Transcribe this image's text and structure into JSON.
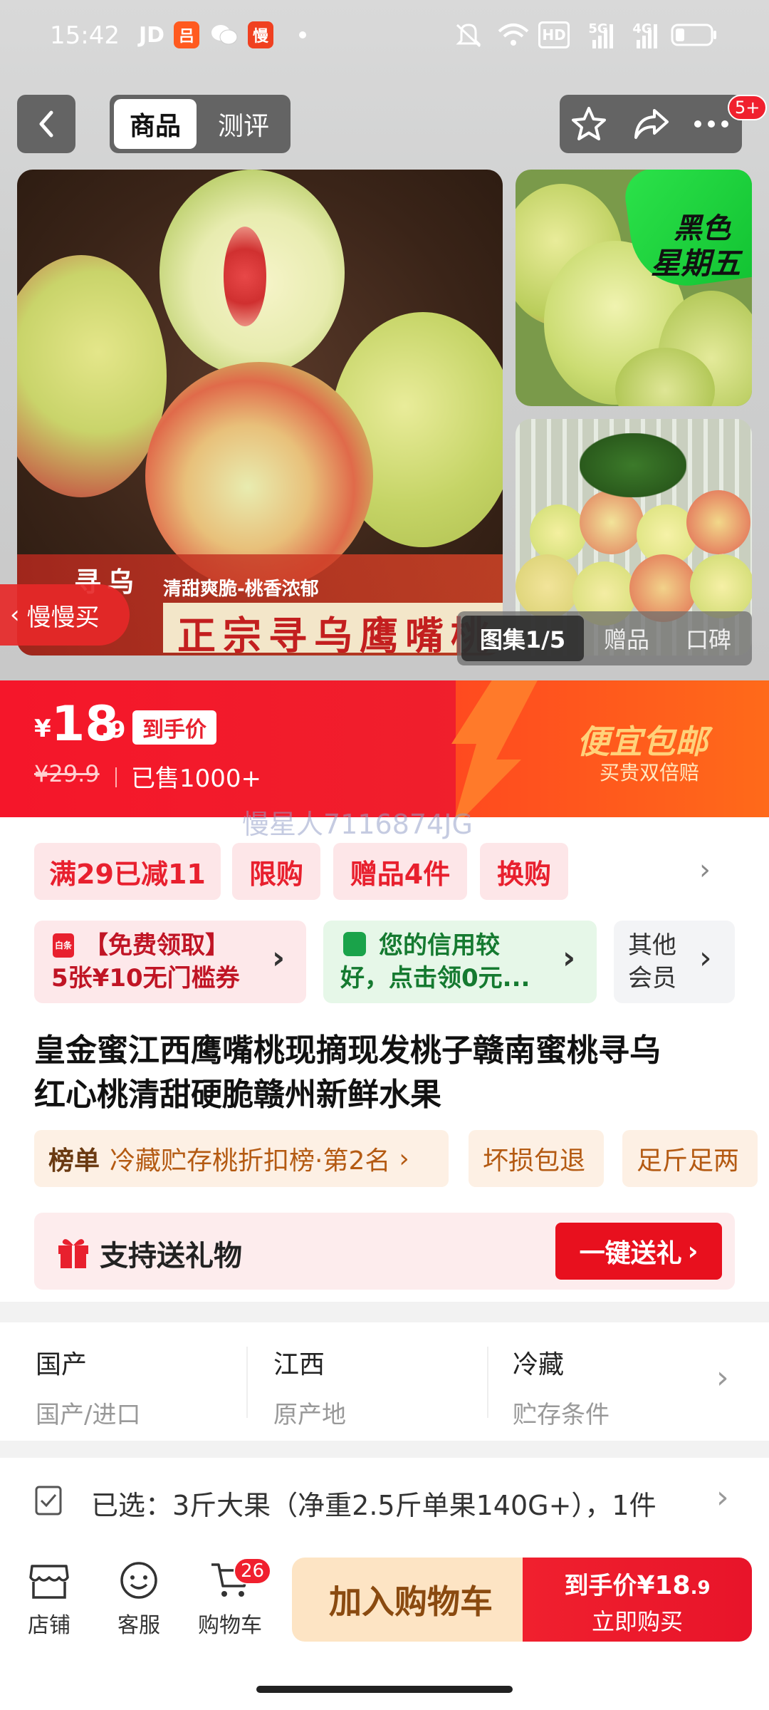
{
  "status_bar": {
    "time": "15:42",
    "icons": [
      "jd-app-icon",
      "meituan-app-icon",
      "wechat-icon",
      "slow-buy-app-icon",
      "dot-icon",
      "mute-icon",
      "wifi-icon",
      "hd-icon",
      "signal-5g-icon",
      "signal-4g-icon",
      "battery-icon"
    ],
    "hd_label": "HD",
    "net1": "5G",
    "net2": "4G"
  },
  "nav": {
    "tabs": [
      {
        "label": "商品",
        "active": true
      },
      {
        "label": "测评",
        "active": false
      }
    ],
    "badge": "5+"
  },
  "gallery": {
    "main_caption_top": "清甜爽脆-桃香浓郁",
    "main_caption_big": "正宗寻乌鹰嘴桃",
    "brand_mark": "寻乌",
    "promo_badge_line1": "黑色",
    "promo_badge_line2": "星期五",
    "slow_buy_label": "慢慢买",
    "tabs": [
      {
        "label": "图集1/5",
        "active": true
      },
      {
        "label": "赠品",
        "active": false
      },
      {
        "label": "口碑",
        "active": false
      }
    ]
  },
  "price": {
    "currency": "¥",
    "integer": "18",
    "decimal": ".9",
    "final_price_tag": "到手价",
    "original_price": "¥29.9",
    "sold": "已售1000+",
    "promo_title": "便宜包邮",
    "promo_sub": "买贵双倍赔",
    "watermark": "慢星人7116874JG"
  },
  "promo_tags": [
    "满29已减11",
    "限购",
    "赠品4件",
    "换购"
  ],
  "cards": {
    "coupon_icon_text": "白条",
    "coupon_line1": "【免费领取】",
    "coupon_line2": "5张¥10无门槛券",
    "credit_line1": "您的信用较",
    "credit_line2": "好，点击领0元...",
    "member_line1": "其他",
    "member_line2": "会员"
  },
  "product": {
    "title_line1": "皇金蜜江西鹰嘴桃现摘现发桃子赣南蜜桃寻乌",
    "title_line2": "红心桃清甜硬脆赣州新鲜水果"
  },
  "chips": {
    "rank_label": "榜单",
    "rank_text": "冷藏贮存桃折扣榜·第2名",
    "chip2": "坏损包退",
    "chip3": "足斤足两"
  },
  "gift": {
    "label": "支持送礼物",
    "button": "一键送礼"
  },
  "specs": [
    {
      "value": "国产",
      "label": "国产/进口"
    },
    {
      "value": "江西",
      "label": "原产地"
    },
    {
      "value": "冷藏",
      "label": "贮存条件"
    }
  ],
  "selected": {
    "text": "已选：3斤大果（净重2.5斤单果140G+），1件"
  },
  "bottom": {
    "store": "店铺",
    "service": "客服",
    "cart": "购物车",
    "cart_count": "26",
    "add_cart": "加入购物车",
    "buy_line1_prefix": "到手价",
    "buy_price": "¥18",
    "buy_price_dec": ".9",
    "buy_line2": "立即购买"
  },
  "colors": {
    "accent_red": "#f01f2c",
    "tag_bg": "#fde6e8",
    "green": "#1aa34a",
    "gold": "#ffd27a"
  }
}
